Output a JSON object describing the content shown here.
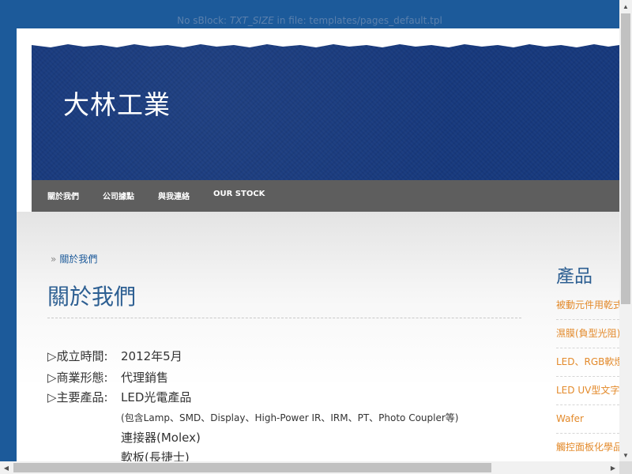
{
  "notice": {
    "prefix": "No sBlock: ",
    "variable": "TXT_SIZE",
    "suffix": " in file: templates/pages_default.tpl"
  },
  "header": {
    "site_title": "大林工業"
  },
  "nav": {
    "items": [
      {
        "label": "關於我們"
      },
      {
        "label": "公司據點"
      },
      {
        "label": "與我連絡"
      },
      {
        "label": "OUR STOCK"
      }
    ]
  },
  "breadcrumb": {
    "separator": "»",
    "current": "關於我們"
  },
  "main": {
    "title": "關於我們",
    "rows": [
      {
        "label": "▷成立時間:",
        "value": "2012年5月"
      },
      {
        "label": "▷商業形態:",
        "value": "代理銷售"
      },
      {
        "label": "▷主要產品:",
        "value": "LED光電產品"
      }
    ],
    "product_note": "(包含Lamp、SMD、Display、High-Power IR、IRM、PT、Photo Coupler等)",
    "products_more": [
      "連接器(Molex)",
      "軟板(長捷士)"
    ]
  },
  "sidebar": {
    "heading": "產品",
    "items": [
      {
        "label": "被動元件用乾式絕緣膜"
      },
      {
        "label": "濕膜(負型光阻)"
      },
      {
        "label": "LED、RGB軟燈條"
      },
      {
        "label": "LED UV型文字噴墨"
      },
      {
        "label": "Wafer"
      },
      {
        "label": "觸控面板化學品"
      }
    ]
  },
  "colors": {
    "background": "#1c5a9a",
    "banner": "#17397d",
    "navbar": "#5e5e5e",
    "title_blue": "#2d5f92",
    "sidebar_link": "#e38a2b"
  },
  "icons": {
    "scroll_up": "triangle-up-icon",
    "scroll_down": "triangle-down-icon",
    "scroll_left": "triangle-left-icon",
    "scroll_right": "triangle-right-icon"
  }
}
